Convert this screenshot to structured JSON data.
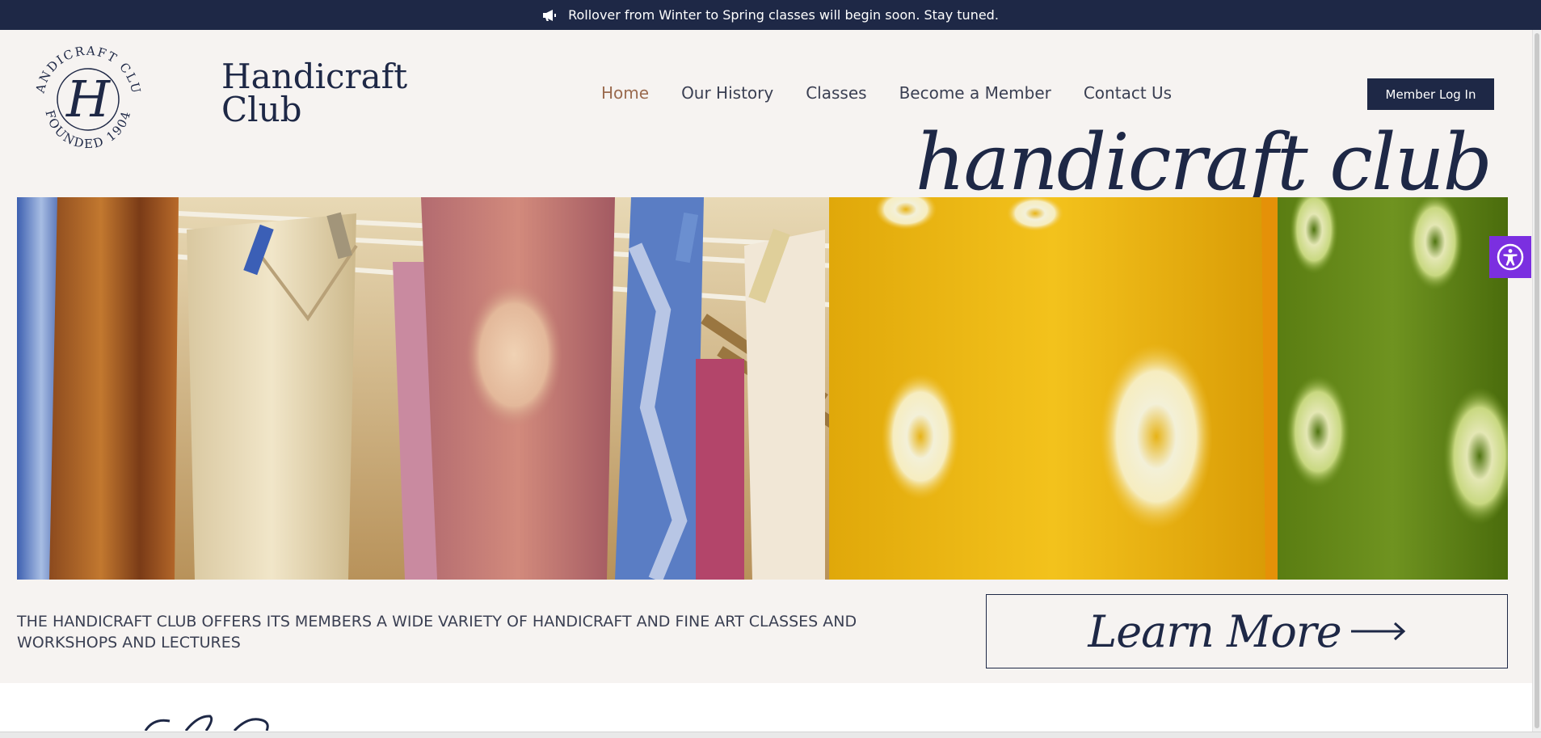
{
  "announcement": {
    "text": "Rollover from Winter to Spring classes will begin soon. Stay tuned.",
    "icon": "megaphone-icon"
  },
  "brand": {
    "name_line1": "Handicraft",
    "name_line2": "Club",
    "seal_top": "HANDICRAFT CLUB",
    "seal_bottom": "FOUNDED 1904",
    "seal_monogram": "H"
  },
  "nav": {
    "items": [
      {
        "label": "Home",
        "active": true
      },
      {
        "label": "Our History",
        "active": false
      },
      {
        "label": "Classes",
        "active": false
      },
      {
        "label": "Become a Member",
        "active": false
      },
      {
        "label": "Contact Us",
        "active": false
      }
    ],
    "login_label": "Member Log In"
  },
  "hero": {
    "script_title": "handicraft club",
    "image": "hanging-dyed-fabrics-photo"
  },
  "intro": {
    "tagline": "The Handicraft Club offers its members a wide variety of handicraft and fine art classes and workshops and lectures",
    "learn_more_label": "Learn More"
  },
  "accessibility": {
    "icon": "accessibility-icon"
  },
  "colors": {
    "navy": "#1e2846",
    "page_bg": "#f6f3f1",
    "accent_active": "#9a6a4e",
    "a11y_purple": "#7b2fe0"
  }
}
